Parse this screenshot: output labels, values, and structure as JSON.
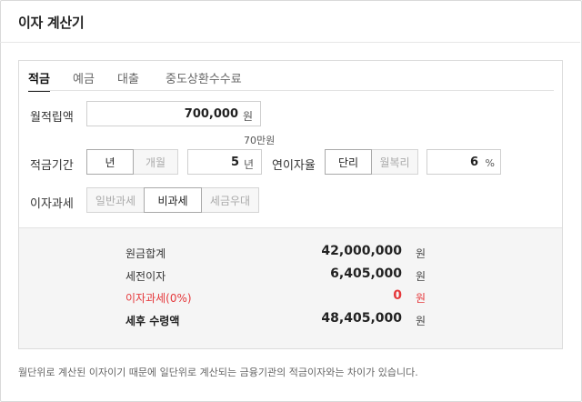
{
  "title": "이자 계산기",
  "tabs": [
    "적금",
    "예금",
    "대출",
    "중도상환수수료"
  ],
  "form": {
    "monthly_label": "월적립액",
    "monthly_value": "700,000",
    "monthly_unit": "원",
    "monthly_hint": "70만원",
    "period_label": "적금기간",
    "period_options": [
      "년",
      "개월"
    ],
    "period_value": "5",
    "period_unit": "년",
    "rate_label": "연이자율",
    "rate_options": [
      "단리",
      "월복리"
    ],
    "rate_value": "6",
    "rate_unit": "%",
    "tax_label": "이자과세",
    "tax_options": [
      "일반과세",
      "비과세",
      "세금우대"
    ]
  },
  "results": [
    {
      "label": "원금합계",
      "value": "42,000,000",
      "unit": "원"
    },
    {
      "label": "세전이자",
      "value": "6,405,000",
      "unit": "원"
    },
    {
      "label": "이자과세(0%)",
      "value": "0",
      "unit": "원"
    },
    {
      "label": "세후 수령액",
      "value": "48,405,000",
      "unit": "원"
    }
  ],
  "note": "월단위로 계산된 이자이기 때문에 일단위로 계산되는 금융기관의 적금이자와는 차이가 있습니다.",
  "colors": {
    "accent_red": "#e5383b",
    "result_bg": "#f5f5f5"
  }
}
